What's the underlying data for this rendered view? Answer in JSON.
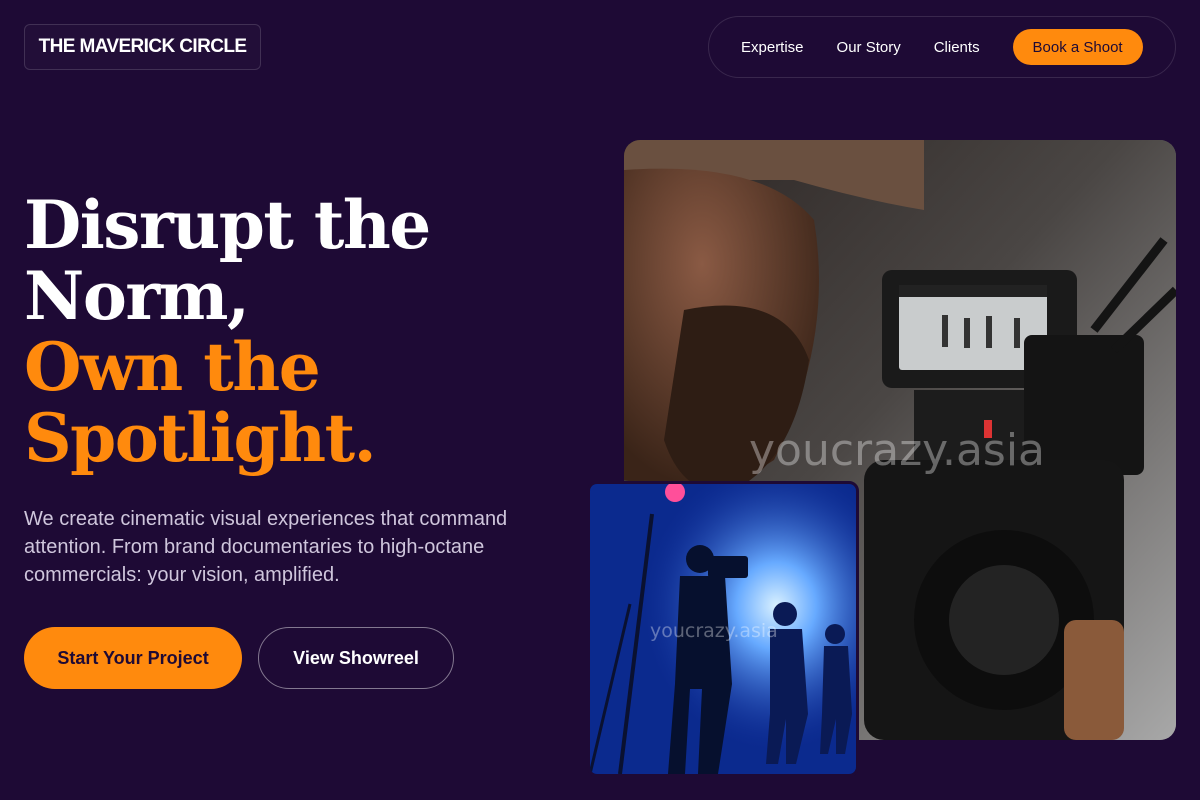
{
  "header": {
    "logo_text": "THE MAVERICK CIRCLE",
    "nav": [
      {
        "label": "Expertise"
      },
      {
        "label": "Our Story"
      },
      {
        "label": "Clients"
      }
    ],
    "cta_label": "Book a Shoot"
  },
  "hero": {
    "headline_line1": "Disrupt the",
    "headline_line2": "Norm,",
    "headline_accent1": "Own the",
    "headline_accent2": "Spotlight.",
    "subtext": "We create cinematic visual experiences that command attention. From brand documentaries to high-octane commercials: your vision, amplified.",
    "primary_button": "Start Your Project",
    "secondary_button": "View Showreel"
  },
  "images": {
    "main_watermark": "youcrazy.asia",
    "small_watermark": "youcrazy.asia"
  },
  "colors": {
    "background": "#1e0a35",
    "accent": "#ff8a0d",
    "text": "#ffffff",
    "muted_text": "#cfc6dc"
  }
}
